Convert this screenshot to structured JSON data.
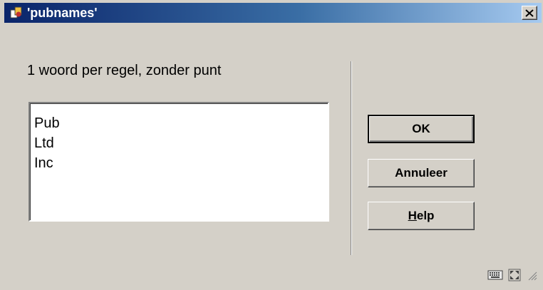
{
  "window": {
    "title": "'pubnames'"
  },
  "instruction": "1 woord per regel, zonder punt",
  "list": {
    "items": [
      "Pub",
      "Ltd",
      "Inc"
    ]
  },
  "buttons": {
    "ok": "OK",
    "cancel": "Annuleer",
    "help_prefix": "H",
    "help_rest": "elp"
  },
  "icons": {
    "app": "app-icon",
    "close": "close-icon",
    "keyboard": "keyboard-icon",
    "resize": "resize-icon",
    "grip": "size-grip-icon"
  },
  "colors": {
    "titlebar_start": "#0a246a",
    "titlebar_end": "#a6caf0",
    "face": "#d4d0c8"
  }
}
